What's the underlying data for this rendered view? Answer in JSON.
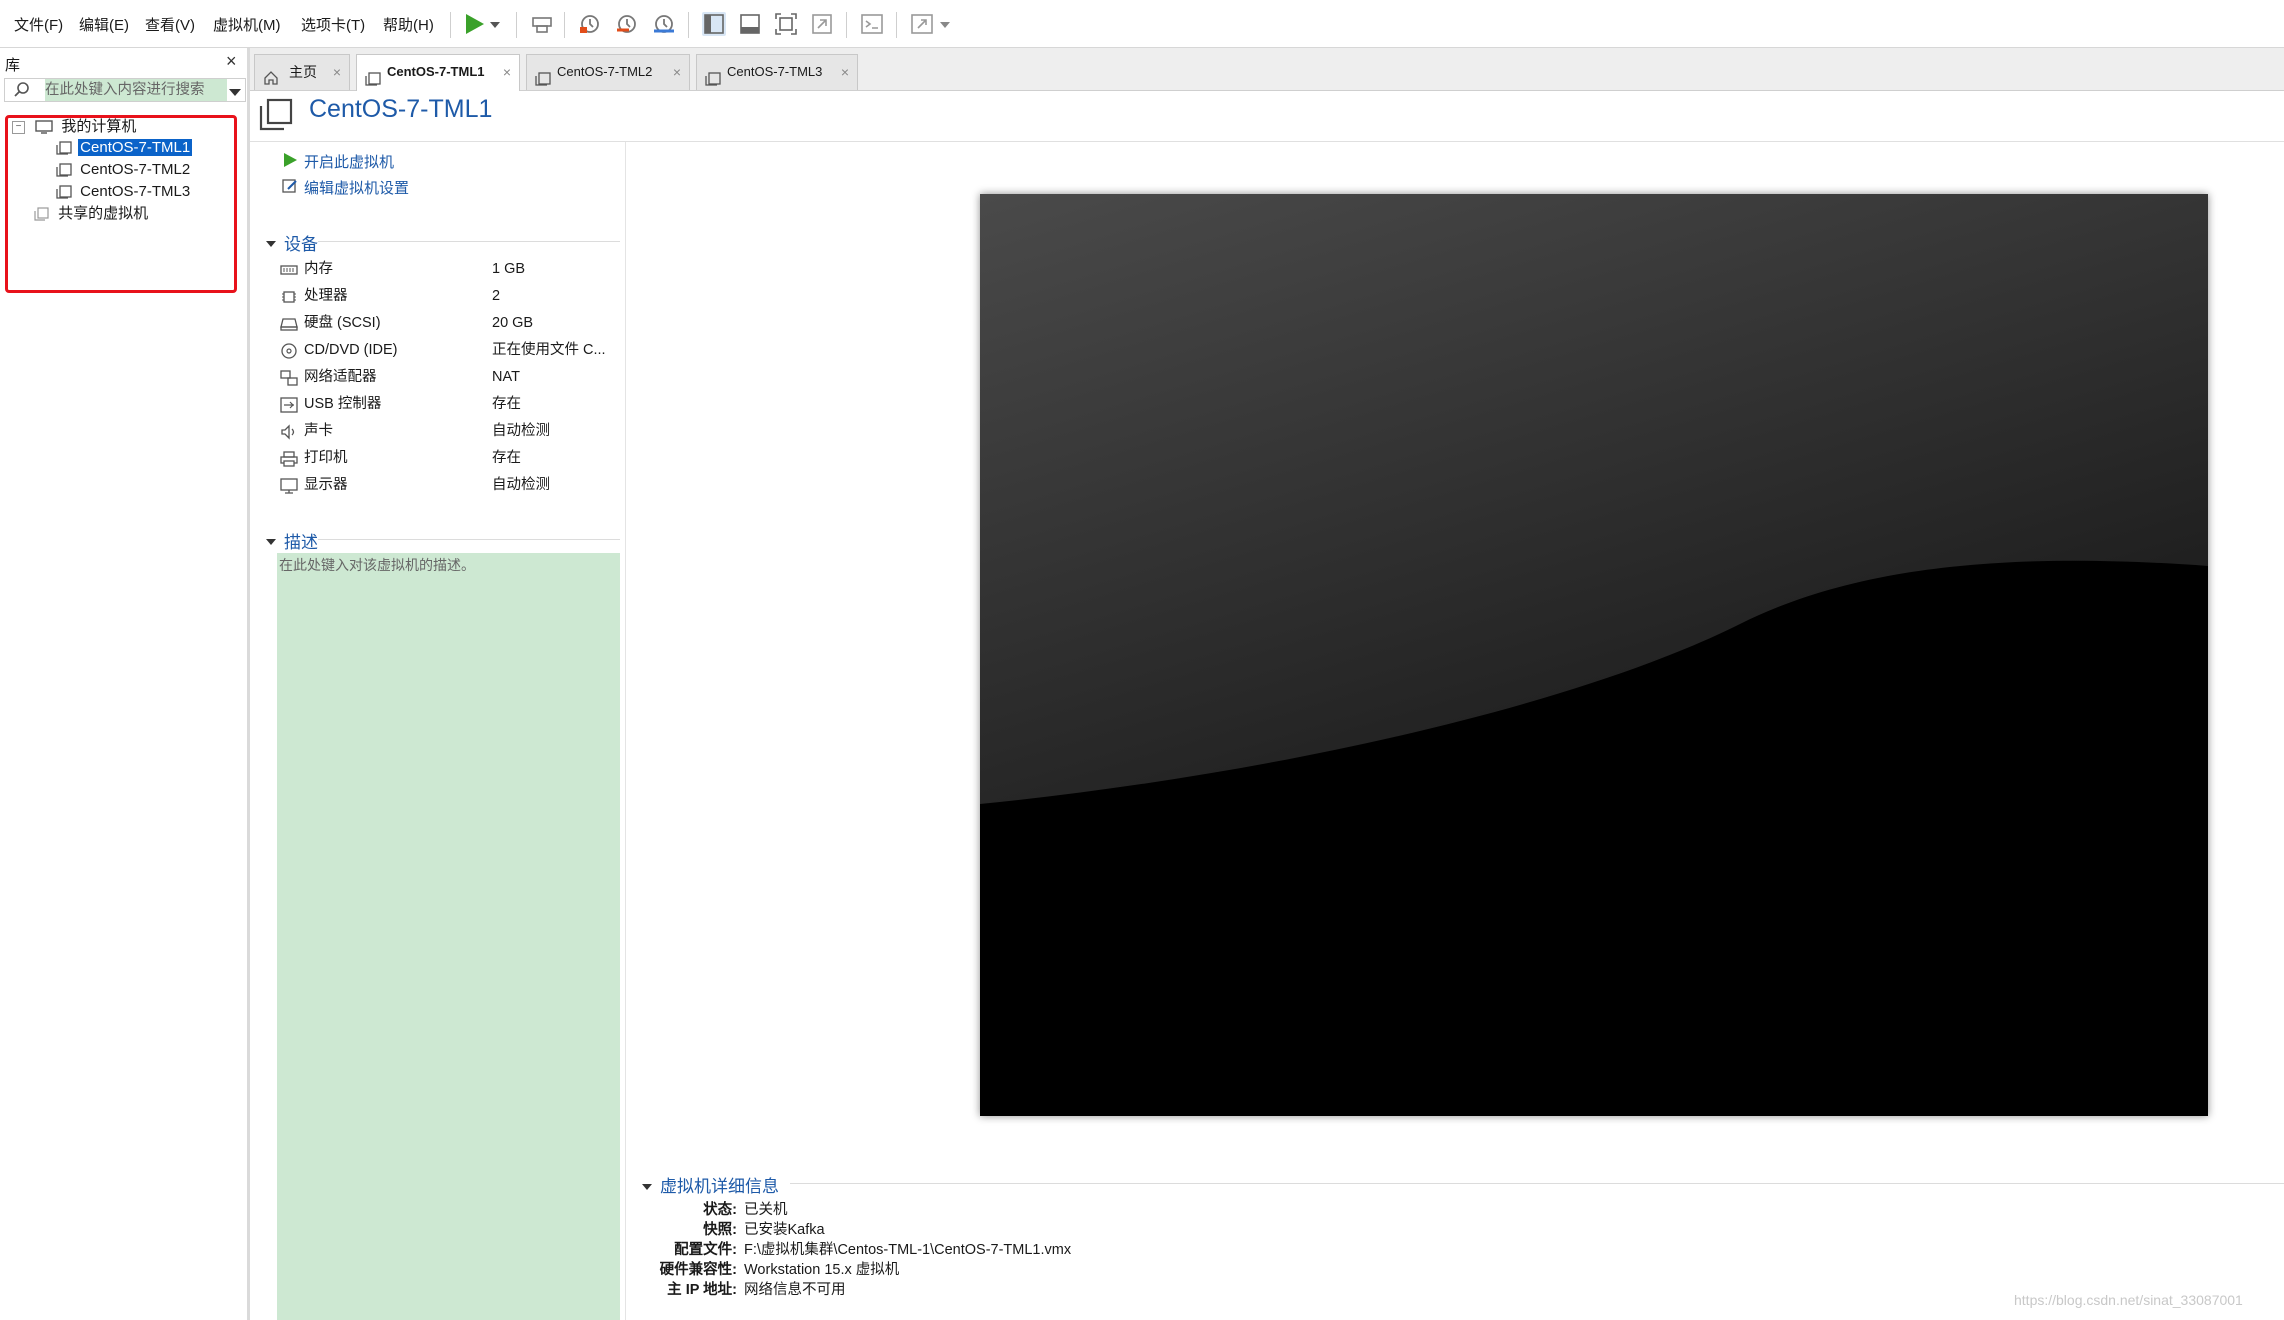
{
  "menu": [
    "文件(F)",
    "编辑(E)",
    "查看(V)",
    "虚拟机(M)",
    "选项卡(T)",
    "帮助(H)"
  ],
  "library": {
    "title": "库",
    "close": "×",
    "search_placeholder": "在此处键入内容进行搜索",
    "tree": {
      "root": "我的计算机",
      "vms": [
        "CentOS-7-TML1",
        "CentOS-7-TML2",
        "CentOS-7-TML3"
      ],
      "shared": "共享的虚拟机"
    }
  },
  "tabs": [
    {
      "label": "主页",
      "icon": "home-icon",
      "active": false
    },
    {
      "label": "CentOS-7-TML1",
      "icon": "vm-icon",
      "active": true
    },
    {
      "label": "CentOS-7-TML2",
      "icon": "vm-icon",
      "active": false
    },
    {
      "label": "CentOS-7-TML3",
      "icon": "vm-icon",
      "active": false
    }
  ],
  "tab_close": "×",
  "vm": {
    "title": "CentOS-7-TML1",
    "actions": {
      "power_on": "开启此虚拟机",
      "edit_settings": "编辑虚拟机设置"
    },
    "devices_title": "设备",
    "devices": [
      {
        "name": "内存",
        "value": "1 GB",
        "icon": "memory-icon"
      },
      {
        "name": "处理器",
        "value": "2",
        "icon": "cpu-icon"
      },
      {
        "name": "硬盘 (SCSI)",
        "value": "20 GB",
        "icon": "harddisk-icon"
      },
      {
        "name": "CD/DVD (IDE)",
        "value": "正在使用文件 C...",
        "icon": "cdrom-icon"
      },
      {
        "name": "网络适配器",
        "value": "NAT",
        "icon": "network-icon"
      },
      {
        "name": "USB 控制器",
        "value": "存在",
        "icon": "usb-icon"
      },
      {
        "name": "声卡",
        "value": "自动检测",
        "icon": "sound-icon"
      },
      {
        "name": "打印机",
        "value": "存在",
        "icon": "printer-icon"
      },
      {
        "name": "显示器",
        "value": "自动检测",
        "icon": "display-icon"
      }
    ],
    "description_title": "描述",
    "description_placeholder": "在此处键入对该虚拟机的描述。",
    "details_title": "虚拟机详细信息",
    "details": [
      {
        "label": "状态:",
        "value": "已关机"
      },
      {
        "label": "快照:",
        "value": "已安装Kafka"
      },
      {
        "label": "配置文件:",
        "value": "F:\\虚拟机集群\\Centos-TML-1\\CentOS-7-TML1.vmx"
      },
      {
        "label": "硬件兼容性:",
        "value": "Workstation 15.x 虚拟机"
      },
      {
        "label": "主 IP 地址:",
        "value": "网络信息不可用"
      }
    ]
  },
  "watermark": "https://blog.csdn.net/sinat_33087001",
  "colors": {
    "accent": "#1e5aa8",
    "selection": "#0b63c9",
    "highlight_box": "#e8121b",
    "description_bg": "#cde8d2",
    "play": "#3aa12a"
  }
}
